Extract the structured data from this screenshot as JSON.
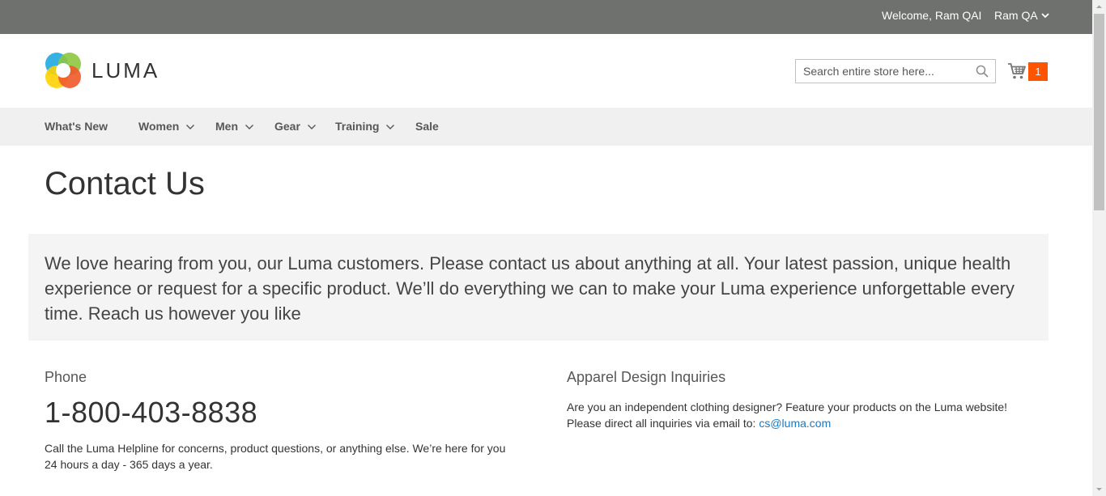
{
  "topbar": {
    "welcome": "Welcome, Ram QAI",
    "account_name": "Ram QA"
  },
  "header": {
    "logo_text": "LUMA",
    "search_placeholder": "Search entire store here...",
    "cart_count": "1"
  },
  "nav": {
    "items": [
      {
        "label": "What's New",
        "has_dropdown": false
      },
      {
        "label": "Women",
        "has_dropdown": true
      },
      {
        "label": "Men",
        "has_dropdown": true
      },
      {
        "label": "Gear",
        "has_dropdown": true
      },
      {
        "label": "Training",
        "has_dropdown": true
      },
      {
        "label": "Sale",
        "has_dropdown": false
      }
    ]
  },
  "page": {
    "title": "Contact Us",
    "intro": "We love hearing from you, our Luma customers. Please contact us about anything at all. Your latest passion, unique health experience or request for a specific product. We’ll do everything we can to make your Luma experience unforgettable every time. Reach us however you like"
  },
  "phone_section": {
    "title": "Phone",
    "number": "1-800-403-8838",
    "description": "Call the Luma Helpline for concerns, product questions, or anything else. We’re here for you 24 hours a day - 365 days a year."
  },
  "apparel_section": {
    "title": "Apparel Design Inquiries",
    "line1": "Are you an independent clothing designer? Feature your products on the Luma website!",
    "line2_prefix": "Please direct all inquiries via email to: ",
    "email": "cs@luma.com"
  },
  "colors": {
    "topbar_bg": "#6e716e",
    "nav_bg": "#f0f0f0",
    "cart_badge": "#ff5501",
    "link": "#1979c3"
  }
}
